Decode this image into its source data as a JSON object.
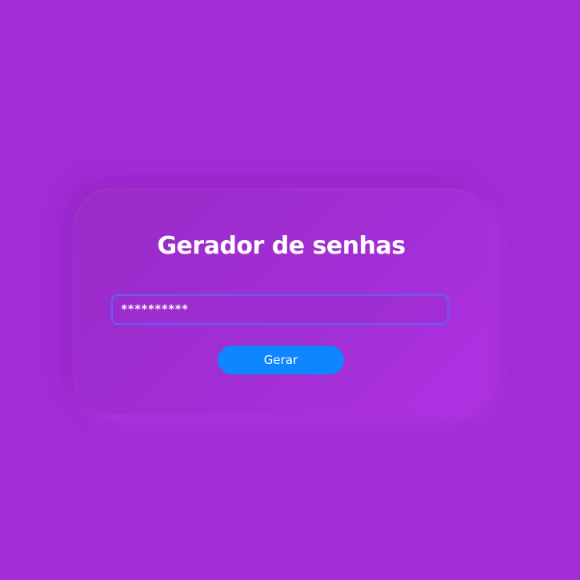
{
  "page": {
    "background_color": "#a32cd6"
  },
  "card": {
    "title": "Gerador de senhas",
    "password_field": {
      "value": "**********"
    },
    "generate_button": {
      "label": "Gerar",
      "color": "#0d86ff"
    }
  }
}
